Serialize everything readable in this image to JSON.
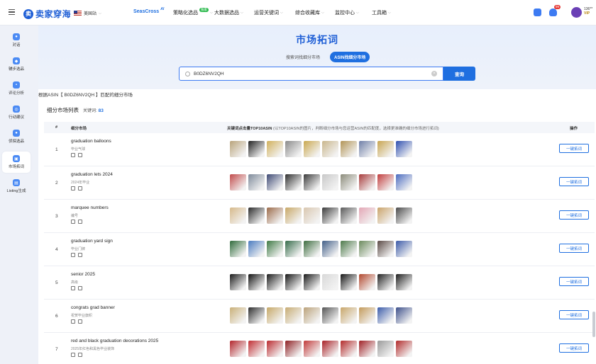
{
  "brand": {
    "logo_mark": "卖",
    "name": "卖家穿海"
  },
  "market": {
    "label": "美国站"
  },
  "nav": [
    {
      "label": "SeasCross",
      "sup": "AI",
      "active": true
    },
    {
      "label": "策略化选品",
      "sup": "独家"
    },
    {
      "label": "大数据选品"
    },
    {
      "label": "运营关键词"
    },
    {
      "label": "综合收藏库"
    },
    {
      "label": "监控中心"
    },
    {
      "label": "工具箱"
    }
  ],
  "notifications": {
    "count": "99"
  },
  "user": {
    "id": "136**",
    "plan": "VIP"
  },
  "sidebar": [
    {
      "label": "对话",
      "icon": "chat-icon"
    },
    {
      "label": "辅步选品",
      "icon": "compass-icon"
    },
    {
      "label": "评论分析",
      "icon": "comment-icon"
    },
    {
      "label": "行动建议",
      "icon": "target-icon"
    },
    {
      "label": "侦探选品",
      "icon": "person-icon"
    },
    {
      "label": "市场拓词",
      "icon": "search-market-icon",
      "active": true
    },
    {
      "label": "Listing生成",
      "icon": "document-icon"
    }
  ],
  "page": {
    "title": "市场拓词"
  },
  "tabs": [
    {
      "label": "搜索词找细分市场"
    },
    {
      "label": "ASIN找细分市场",
      "active": true
    }
  ],
  "search": {
    "value": "B0DZ6NV2QH",
    "button": "查询"
  },
  "result_note": "根据ASIN【 B0DZ6NV2QH 】匹配的细分市场",
  "list": {
    "title": "细分市场列表",
    "count_label": "关键词:",
    "count": "83"
  },
  "table": {
    "headers": {
      "idx": "#",
      "market": "细分市场",
      "top10": "关键词点击量TOP10ASIN",
      "top10_note": "(以TOP10ASIN的图片，判断细分市场与您运营ASIN的匹配度，选择更准确的细分市场进行拓词)",
      "action": "操作"
    },
    "action_label": "一键拓词",
    "rows": [
      {
        "idx": "1",
        "name": "graduation balloons",
        "cn": "毕业气球",
        "thumbs": [
          "#b9a37a",
          "#222222",
          "#d1b15c",
          "#8a8a8a",
          "#caa84f",
          "#c9b68b",
          "#b29456",
          "#6f7fa8",
          "#c8a550",
          "#2e4fb0"
        ]
      },
      {
        "idx": "2",
        "name": "graduation lets 2024",
        "cn": "2024年毕业",
        "thumbs": [
          "#c14a4a",
          "#7e8a9a",
          "#3e4a75",
          "#2f2f2f",
          "#3a3a3a",
          "#c8c8c8",
          "#8b8b7a",
          "#a83b3b",
          "#c23d3d",
          "#4a6bc0"
        ]
      },
      {
        "idx": "3",
        "name": "marquee numbers",
        "cn": "编号",
        "thumbs": [
          "#d6b98a",
          "#2b2b2b",
          "#9c6b4a",
          "#c8a867",
          "#d9c7b0",
          "#3a3a3a",
          "#5a5a5a",
          "#e3a7b5",
          "#caa36a",
          "#4a4a4a"
        ]
      },
      {
        "idx": "4",
        "name": "graduation yard sign",
        "cn": "毕业门牌",
        "thumbs": [
          "#2f6b3a",
          "#4a7bc0",
          "#3f7a45",
          "#356c4a",
          "#3d6d3f",
          "#425f88",
          "#4d7a4a",
          "#6b8a5c",
          "#5b4a45",
          "#3b5aa8"
        ]
      },
      {
        "idx": "5",
        "name": "senior 2025",
        "cn": "高级",
        "thumbs": [
          "#1a1a1a",
          "#111111",
          "#1c1c1c",
          "#151515",
          "#181818",
          "#d8d8d8",
          "#161616",
          "#b2472d",
          "#222222",
          "#1d1d1d"
        ]
      },
      {
        "idx": "6",
        "name": "congrats grad banner",
        "cn": "祝贺毕业旗帜",
        "thumbs": [
          "#c9b078",
          "#2d2d2d",
          "#c6a867",
          "#c7ac73",
          "#bba27a",
          "#555555",
          "#c8a66a",
          "#c39a5a",
          "#3b5caa",
          "#3c4f8a"
        ]
      },
      {
        "idx": "7",
        "name": "red and black graduation decorations 2025",
        "cn": "2025年红色和黑色毕业装饰",
        "thumbs": [
          "#b3242a",
          "#c12d32",
          "#bb2a2f",
          "#8e1f22",
          "#c23a3a",
          "#a92126",
          "#b32a2a",
          "#a02025",
          "#9a9a9a",
          "#b22a2a"
        ]
      }
    ]
  }
}
